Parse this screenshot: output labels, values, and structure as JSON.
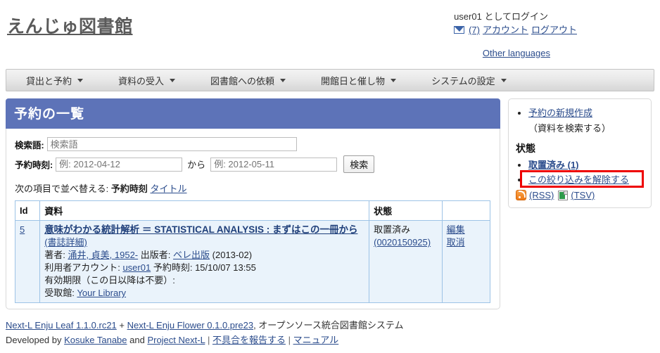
{
  "header": {
    "site_title": "えんじゅ図書館",
    "login_user": "user01",
    "login_suffix": " としてログイン",
    "message_icon": "envelope-icon",
    "message_count": "(7)",
    "account_link": "アカウント",
    "logout_link": "ログアウト",
    "other_languages": "Other languages"
  },
  "nav": {
    "items": [
      {
        "label": "貸出と予約"
      },
      {
        "label": "資料の受入"
      },
      {
        "label": "図書館への依頼"
      },
      {
        "label": "開館日と催し物"
      },
      {
        "label": "システムの設定"
      }
    ]
  },
  "main": {
    "panel_title": "予約の一覧",
    "search": {
      "query_label": "検索語:",
      "query_value": "",
      "query_placeholder": "検索語",
      "date_label": "予約時刻:",
      "date_from_value": "",
      "date_from_placeholder": "例: 2012-04-12",
      "between_label": "から",
      "date_to_value": "",
      "date_to_placeholder": "例: 2012-05-11",
      "submit_label": "検索"
    },
    "sort": {
      "prefix": "次の項目で並べ替える:",
      "current": "予約時刻",
      "other": "タイトル"
    },
    "table": {
      "headers": [
        "Id",
        "資料",
        "状態",
        ""
      ],
      "rows": [
        {
          "id": "5",
          "title": "意味がわかる統計解析 ＝ STATISTICAL ANALYSIS : まずはこの一冊から",
          "detail_link": "(書誌詳細)",
          "author_label": "著者:",
          "author": "涌井, 貞美, 1952-",
          "publisher_label": "出版者:",
          "publisher": "ベレ出版",
          "pubdate": "(2013-02)",
          "account_label": "利用者アカウント:",
          "account": "user01",
          "reserved_label": "予約時刻:",
          "reserved_at": "15/10/07 13:55",
          "expire_label": "有効期限（この日以降は不要）:",
          "expire_value": "",
          "pickup_label": "受取館:",
          "pickup": "Your Library",
          "state": "取置済み",
          "state_code": "(0020150925)",
          "actions": [
            "編集",
            "取消"
          ]
        }
      ]
    }
  },
  "sidebar": {
    "new_reserve": "予約の新規作成",
    "search_material_note": "（資料を検索する）",
    "state_heading": "状態",
    "state_items": [
      {
        "label": "取置済み (1)"
      }
    ],
    "clear_filter": "この絞り込みを解除する",
    "rss_icon": "rss-icon",
    "rss_label": "(RSS)",
    "tsv_icon": "tsv-icon",
    "tsv_label": "(TSV)",
    "highlight_color": "#ee0000"
  },
  "footer": {
    "leaf": "Next-L Enju Leaf 1.1.0.rc21",
    "plus": " + ",
    "flower": "Next-L Enju Flower 0.1.0.pre23",
    "tagline": ", オープンソース統合図書館システム",
    "dev_prefix": "Developed by ",
    "dev_name": "Kosuke Tanabe",
    "dev_and": " and ",
    "project": "Project Next-L",
    "sep1": " | ",
    "bug_report": "不具合を報告する",
    "sep2": " | ",
    "manual": "マニュアル"
  }
}
